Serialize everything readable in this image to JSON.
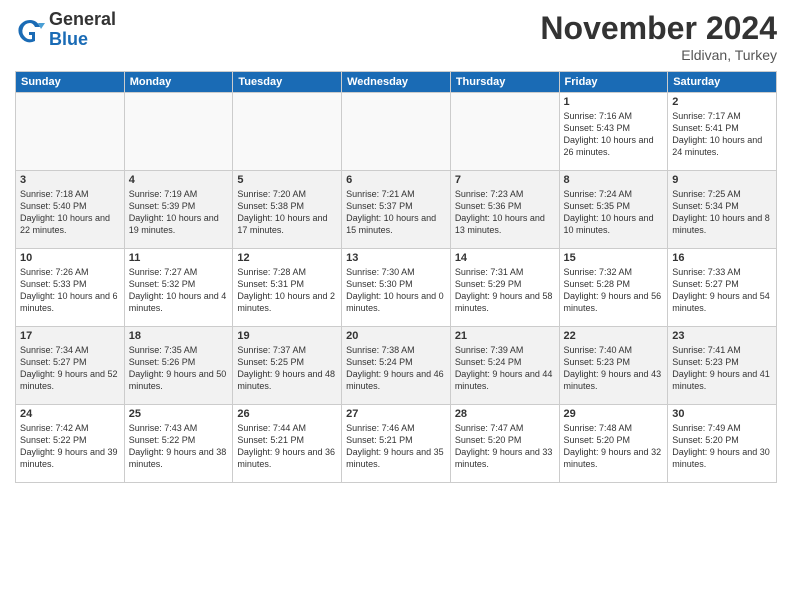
{
  "logo": {
    "general": "General",
    "blue": "Blue"
  },
  "header": {
    "month": "November 2024",
    "location": "Eldivan, Turkey"
  },
  "weekdays": [
    "Sunday",
    "Monday",
    "Tuesday",
    "Wednesday",
    "Thursday",
    "Friday",
    "Saturday"
  ],
  "weeks": [
    [
      {
        "day": "",
        "info": ""
      },
      {
        "day": "",
        "info": ""
      },
      {
        "day": "",
        "info": ""
      },
      {
        "day": "",
        "info": ""
      },
      {
        "day": "",
        "info": ""
      },
      {
        "day": "1",
        "info": "Sunrise: 7:16 AM\nSunset: 5:43 PM\nDaylight: 10 hours\nand 26 minutes."
      },
      {
        "day": "2",
        "info": "Sunrise: 7:17 AM\nSunset: 5:41 PM\nDaylight: 10 hours\nand 24 minutes."
      }
    ],
    [
      {
        "day": "3",
        "info": "Sunrise: 7:18 AM\nSunset: 5:40 PM\nDaylight: 10 hours\nand 22 minutes."
      },
      {
        "day": "4",
        "info": "Sunrise: 7:19 AM\nSunset: 5:39 PM\nDaylight: 10 hours\nand 19 minutes."
      },
      {
        "day": "5",
        "info": "Sunrise: 7:20 AM\nSunset: 5:38 PM\nDaylight: 10 hours\nand 17 minutes."
      },
      {
        "day": "6",
        "info": "Sunrise: 7:21 AM\nSunset: 5:37 PM\nDaylight: 10 hours\nand 15 minutes."
      },
      {
        "day": "7",
        "info": "Sunrise: 7:23 AM\nSunset: 5:36 PM\nDaylight: 10 hours\nand 13 minutes."
      },
      {
        "day": "8",
        "info": "Sunrise: 7:24 AM\nSunset: 5:35 PM\nDaylight: 10 hours\nand 10 minutes."
      },
      {
        "day": "9",
        "info": "Sunrise: 7:25 AM\nSunset: 5:34 PM\nDaylight: 10 hours\nand 8 minutes."
      }
    ],
    [
      {
        "day": "10",
        "info": "Sunrise: 7:26 AM\nSunset: 5:33 PM\nDaylight: 10 hours\nand 6 minutes."
      },
      {
        "day": "11",
        "info": "Sunrise: 7:27 AM\nSunset: 5:32 PM\nDaylight: 10 hours\nand 4 minutes."
      },
      {
        "day": "12",
        "info": "Sunrise: 7:28 AM\nSunset: 5:31 PM\nDaylight: 10 hours\nand 2 minutes."
      },
      {
        "day": "13",
        "info": "Sunrise: 7:30 AM\nSunset: 5:30 PM\nDaylight: 10 hours\nand 0 minutes."
      },
      {
        "day": "14",
        "info": "Sunrise: 7:31 AM\nSunset: 5:29 PM\nDaylight: 9 hours\nand 58 minutes."
      },
      {
        "day": "15",
        "info": "Sunrise: 7:32 AM\nSunset: 5:28 PM\nDaylight: 9 hours\nand 56 minutes."
      },
      {
        "day": "16",
        "info": "Sunrise: 7:33 AM\nSunset: 5:27 PM\nDaylight: 9 hours\nand 54 minutes."
      }
    ],
    [
      {
        "day": "17",
        "info": "Sunrise: 7:34 AM\nSunset: 5:27 PM\nDaylight: 9 hours\nand 52 minutes."
      },
      {
        "day": "18",
        "info": "Sunrise: 7:35 AM\nSunset: 5:26 PM\nDaylight: 9 hours\nand 50 minutes."
      },
      {
        "day": "19",
        "info": "Sunrise: 7:37 AM\nSunset: 5:25 PM\nDaylight: 9 hours\nand 48 minutes."
      },
      {
        "day": "20",
        "info": "Sunrise: 7:38 AM\nSunset: 5:24 PM\nDaylight: 9 hours\nand 46 minutes."
      },
      {
        "day": "21",
        "info": "Sunrise: 7:39 AM\nSunset: 5:24 PM\nDaylight: 9 hours\nand 44 minutes."
      },
      {
        "day": "22",
        "info": "Sunrise: 7:40 AM\nSunset: 5:23 PM\nDaylight: 9 hours\nand 43 minutes."
      },
      {
        "day": "23",
        "info": "Sunrise: 7:41 AM\nSunset: 5:23 PM\nDaylight: 9 hours\nand 41 minutes."
      }
    ],
    [
      {
        "day": "24",
        "info": "Sunrise: 7:42 AM\nSunset: 5:22 PM\nDaylight: 9 hours\nand 39 minutes."
      },
      {
        "day": "25",
        "info": "Sunrise: 7:43 AM\nSunset: 5:22 PM\nDaylight: 9 hours\nand 38 minutes."
      },
      {
        "day": "26",
        "info": "Sunrise: 7:44 AM\nSunset: 5:21 PM\nDaylight: 9 hours\nand 36 minutes."
      },
      {
        "day": "27",
        "info": "Sunrise: 7:46 AM\nSunset: 5:21 PM\nDaylight: 9 hours\nand 35 minutes."
      },
      {
        "day": "28",
        "info": "Sunrise: 7:47 AM\nSunset: 5:20 PM\nDaylight: 9 hours\nand 33 minutes."
      },
      {
        "day": "29",
        "info": "Sunrise: 7:48 AM\nSunset: 5:20 PM\nDaylight: 9 hours\nand 32 minutes."
      },
      {
        "day": "30",
        "info": "Sunrise: 7:49 AM\nSunset: 5:20 PM\nDaylight: 9 hours\nand 30 minutes."
      }
    ]
  ]
}
